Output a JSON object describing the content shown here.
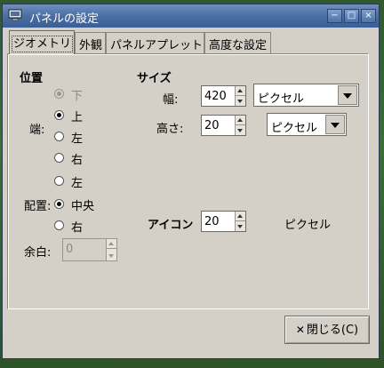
{
  "window": {
    "title": "パネルの設定"
  },
  "titlebar_buttons": {
    "minimize": "−",
    "maximize": "□",
    "close": "×"
  },
  "tabs": [
    {
      "label": "ジオメトリ",
      "active": true
    },
    {
      "label": "外観",
      "active": false
    },
    {
      "label": "パネルアプレット",
      "active": false
    },
    {
      "label": "高度な設定",
      "active": false
    }
  ],
  "position": {
    "heading": "位置",
    "edge_label": "端:",
    "edge_options": [
      {
        "label": "下",
        "checked": true,
        "disabled": true
      },
      {
        "label": "上",
        "checked": true,
        "disabled": false
      },
      {
        "label": "左",
        "checked": false,
        "disabled": false
      },
      {
        "label": "右",
        "checked": false,
        "disabled": false
      }
    ],
    "align_label": "配置:",
    "align_options": [
      {
        "label": "左",
        "checked": false
      },
      {
        "label": "中央",
        "checked": true
      },
      {
        "label": "右",
        "checked": false
      }
    ],
    "margin_label": "余白:",
    "margin_value": "0"
  },
  "size": {
    "heading": "サイズ",
    "width_label": "幅:",
    "width_value": "420",
    "width_unit": "ピクセル",
    "height_label": "高さ:",
    "height_value": "20",
    "height_unit": "ピクセル"
  },
  "icon": {
    "label": "アイコン",
    "value": "20",
    "unit": "ピクセル"
  },
  "footer": {
    "close_label": "閉じる(C)"
  }
}
